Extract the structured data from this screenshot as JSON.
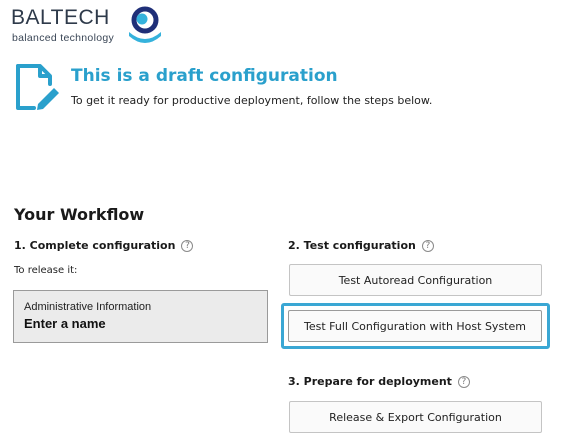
{
  "logo": {
    "name": "BALTECH",
    "tagline": "balanced technology",
    "icon": "baltech-logo-mark"
  },
  "draft": {
    "icon": "edit-document-icon",
    "title": "This is a draft configuration",
    "subtitle": "To get it ready for productive deployment, follow the steps below."
  },
  "workflow": {
    "heading": "Your Workflow",
    "step1": {
      "title": "1. Complete configuration",
      "help_icon": "?",
      "release_text": "To release it:",
      "admin_box": {
        "label": "Administrative Information",
        "value": "Enter a name"
      }
    },
    "step2": {
      "title": "2. Test configuration",
      "help_icon": "?",
      "buttons": {
        "autoread": "Test Autoread Configuration",
        "full": "Test Full Configuration with Host System"
      }
    },
    "step3": {
      "title": "3. Prepare for deployment",
      "help_icon": "?",
      "buttons": {
        "release": "Release & Export Configuration"
      }
    }
  },
  "colors": {
    "accent": "#2aa0cc",
    "focus": "#3aa7d4",
    "logo_dark": "#2e3a4a",
    "logo_navy": "#1f2f78"
  }
}
